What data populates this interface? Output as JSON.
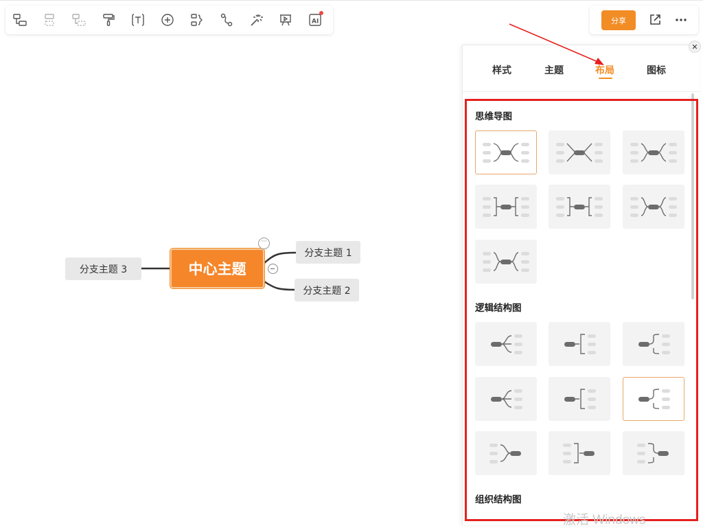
{
  "toolbar": {
    "tools": [
      {
        "icon": "insert-child-topic-icon"
      },
      {
        "icon": "insert-sibling-topic-icon"
      },
      {
        "icon": "insert-floating-topic-icon"
      },
      {
        "icon": "format-painter-icon"
      },
      {
        "icon": "text-box-icon"
      },
      {
        "icon": "add-circle-icon"
      },
      {
        "icon": "summary-icon"
      },
      {
        "icon": "relationship-line-icon"
      },
      {
        "icon": "magic-wand-icon"
      },
      {
        "icon": "presentation-icon"
      },
      {
        "icon": "ai-icon",
        "label": "AI"
      }
    ]
  },
  "share": {
    "label": "分享"
  },
  "mindmap": {
    "central": "中心主题",
    "branches": [
      "分支主题 1",
      "分支主题 2",
      "分支主题 3"
    ]
  },
  "panel": {
    "tabs": [
      "样式",
      "主题",
      "布局",
      "图标"
    ],
    "active_tab": "布局",
    "sections": [
      {
        "title": "思维导图",
        "layouts": 7,
        "selected_index": 0
      },
      {
        "title": "逻辑结构图",
        "layouts": 9,
        "selected_index": 5
      },
      {
        "title": "组织结构图"
      }
    ]
  },
  "colors": {
    "accent": "#f28c24",
    "annotation": "#e5201e",
    "branch_bg": "#e8e8e8"
  },
  "watermark": "激活 Windows"
}
